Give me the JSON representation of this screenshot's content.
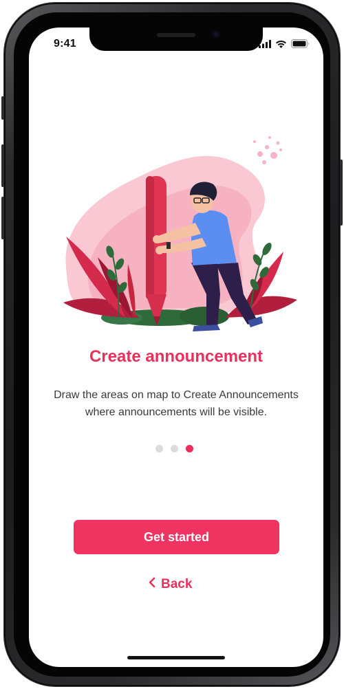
{
  "status_bar": {
    "time": "9:41",
    "icons": [
      "signal-icon",
      "wifi-icon",
      "battery-icon"
    ]
  },
  "onboarding": {
    "illustration": "person-holding-pencil-illustration",
    "title": "Create announcement",
    "description": "Draw the areas on map to Create Announcements where announcements will be visible.",
    "pagination": {
      "total": 3,
      "active_index": 2
    },
    "primary_button": "Get started",
    "back_link": "Back"
  },
  "colors": {
    "accent": "#e9305b",
    "button": "#ef3461",
    "dot_inactive": "#dcdcdc",
    "text": "#3a3a3a"
  }
}
